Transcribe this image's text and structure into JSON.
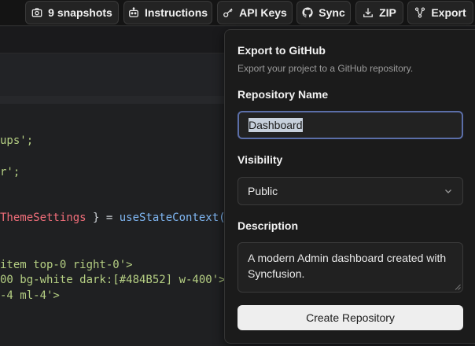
{
  "toolbar": {
    "snapshots_label": "9 snapshots",
    "instructions_label": "Instructions",
    "api_keys_label": "API Keys",
    "sync_label": "Sync",
    "zip_label": "ZIP",
    "export_label": "Export",
    "icons": [
      "camera-icon",
      "robot-icon",
      "key-icon",
      "github-icon",
      "download-icon",
      "share-nodes-icon"
    ]
  },
  "code": {
    "line1": "ups';",
    "line2": "r';",
    "line3_a": "ThemeSettings",
    "line3_b": " } = ",
    "line3_c": "useStateContext(",
    "line4": "item top-0 right-0'>",
    "line5": "00 bg-white dark:[#484B52] w-400'>",
    "line6": "-4 ml-4'>"
  },
  "export_panel": {
    "title": "Export to GitHub",
    "subtitle": "Export your project to a GitHub repository.",
    "repo_name_label": "Repository Name",
    "repo_name_value": "Dashboard",
    "visibility_label": "Visibility",
    "visibility_value": "Public",
    "description_label": "Description",
    "description_value": "A modern Admin dashboard created with Syncfusion.",
    "create_button_label": "Create Repository"
  },
  "colors": {
    "panel_bg": "#1b1b1b",
    "input_focus_border": "#5b6ea8",
    "button_bg": "#eeeeee"
  }
}
